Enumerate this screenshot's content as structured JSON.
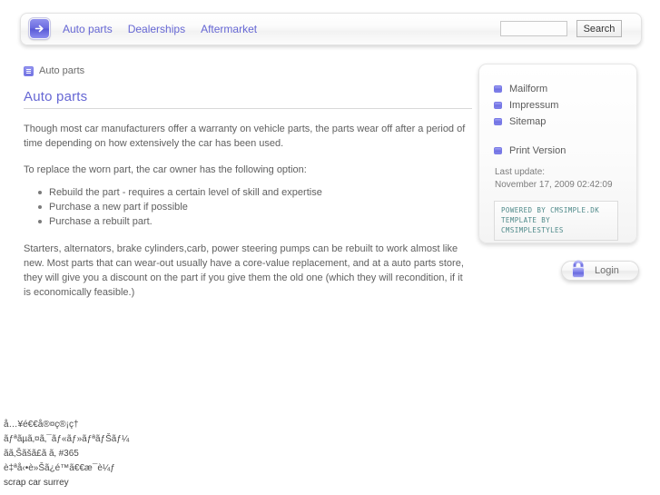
{
  "header": {
    "logo_icon": "arrow-right-icon",
    "nav": [
      {
        "label": "Auto parts"
      },
      {
        "label": "Dealerships"
      },
      {
        "label": "Aftermarket"
      }
    ],
    "search": {
      "value": "",
      "placeholder": "",
      "button_label": "Search"
    }
  },
  "breadcrumb": {
    "icon": "list-icon",
    "label": "Auto parts"
  },
  "main": {
    "title": "Auto parts",
    "paragraph1": "Though most car manufacturers offer a warranty on vehicle parts, the parts wear off after a period of time depending on how extensively the car has been used.",
    "paragraph2": "To replace the worn part, the car owner has the following option:",
    "list": [
      "Rebuild the part - requires a certain level of skill and expertise",
      "Purchase a new part if possible",
      "Purchase a rebuilt part."
    ],
    "paragraph3": "Starters, alternators, brake cylinders,carb, power steering pumps can be rebuilt to work almost like new. Most parts that can wear-out usually have a  core-value replacement, and at a auto parts store, they will give you a discount on the part if you give them the old one (which they will recondition, if it is economically feasible.)"
  },
  "sidebar": {
    "links": [
      {
        "label": "Mailform",
        "icon": "square-icon"
      },
      {
        "label": "Impressum",
        "icon": "square-icon"
      },
      {
        "label": "Sitemap",
        "icon": "square-icon"
      },
      {
        "label": "Print Version",
        "icon": "square-icon"
      }
    ],
    "last_update_label": "Last update:",
    "last_update_value": "November 17, 2009 02:42:09",
    "powered_line1": "Powered by cmsimple.dk",
    "powered_line2": "Template by cmsimplestyles"
  },
  "login": {
    "icon": "padlock-icon",
    "label": "Login"
  },
  "footer_keywords": [
    "å…¥é€€å®¤ç®¡ç†",
    "ãƒªãµã‚¤ã‚¯ãƒ«ãƒ»ãƒªãƒŠãƒ¼",
    "ãã‚Šãšã£ã ã‚ #365",
    "è‡ªå‹•è»Šã¿é™ã€€æ¯è¼ƒ",
    "scrap car surrey"
  ],
  "colors": {
    "accent": "#6667d4",
    "text": "#606060",
    "badge_text": "#4f8a8a"
  }
}
